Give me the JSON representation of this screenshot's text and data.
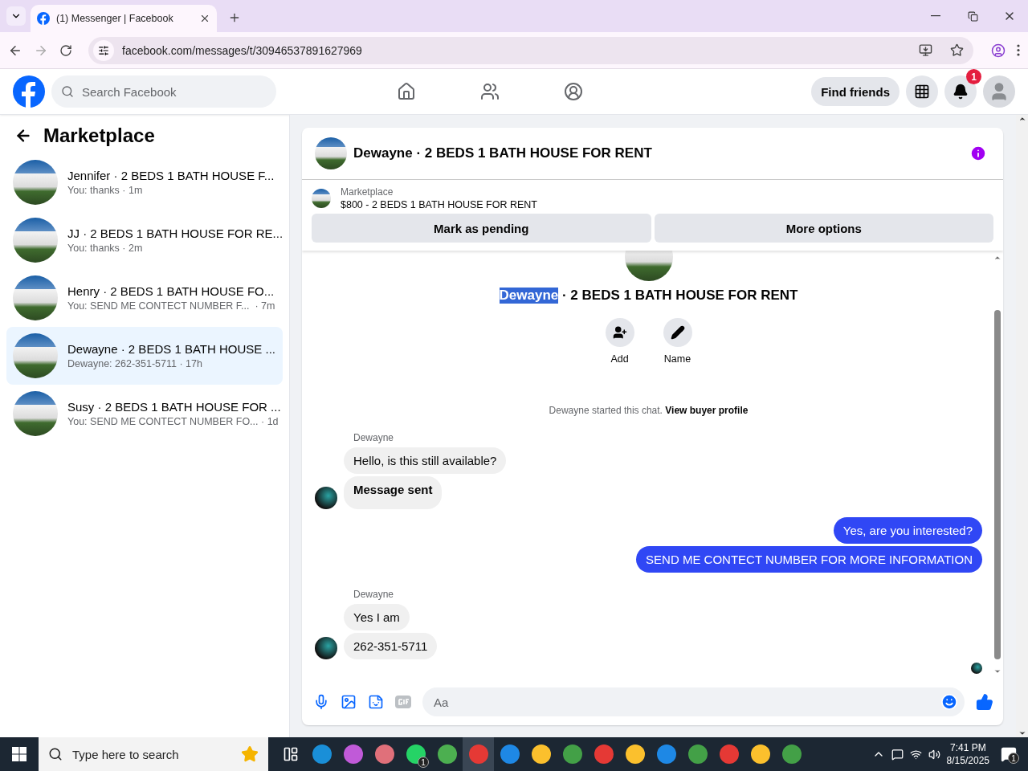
{
  "browser": {
    "tab_title": "(1) Messenger | Facebook",
    "url": "facebook.com/messages/t/30946537891627969"
  },
  "header": {
    "search_placeholder": "Search Facebook",
    "find_friends": "Find friends",
    "notification_count": "1"
  },
  "sidebar": {
    "title": "Marketplace",
    "conversations": [
      {
        "title": "Jennifer · 2 BEDS 1 BATH HOUSE F...",
        "preview": "You: thanks · 1m",
        "selected": false
      },
      {
        "title": "JJ · 2 BEDS 1 BATH HOUSE FOR RE...",
        "preview": "You: thanks · 2m",
        "selected": false
      },
      {
        "title": "Henry · 2 BEDS 1 BATH HOUSE FO...",
        "preview": "You: SEND ME CONTECT NUMBER F...  · 7m",
        "selected": false
      },
      {
        "title": "Dewayne · 2 BEDS 1 BATH HOUSE ...",
        "preview": "Dewayne: 262-351-5711 · 17h",
        "selected": true
      },
      {
        "title": "Susy · 2 BEDS 1 BATH HOUSE FOR ...",
        "preview": "You: SEND ME CONTECT NUMBER FO... · 1d",
        "selected": false
      }
    ]
  },
  "chat": {
    "title": "Dewayne · 2 BEDS 1 BATH HOUSE FOR RENT",
    "listing": {
      "source": "Marketplace",
      "title": "$800 - 2 BEDS 1 BATH HOUSE FOR RENT",
      "buttons": [
        "Mark as pending",
        "More options"
      ]
    },
    "intro": {
      "name": "Dewayne",
      "name_highlighted": true,
      "rest": " · 2 BEDS 1 BATH HOUSE FOR RENT",
      "actions": [
        {
          "kind": "add",
          "label": "Add"
        },
        {
          "kind": "name",
          "label": "Name"
        }
      ],
      "notice": "Dewayne started this chat.",
      "notice_link": "View buyer profile"
    },
    "groups": [
      {
        "kind": "incoming",
        "sender": "Dewayne",
        "messages": [
          {
            "text": "Hello, is this still available?",
            "bold": false
          },
          {
            "text": "Message sent",
            "bold": true
          }
        ]
      },
      {
        "kind": "outgoing",
        "messages": [
          {
            "text": "Yes, are you interested?",
            "bold": false
          },
          {
            "text": "SEND ME CONTECT NUMBER FOR MORE INFORMATION",
            "bold": false
          }
        ]
      },
      {
        "kind": "incoming",
        "sender": "Dewayne",
        "messages": [
          {
            "text": "Yes I am",
            "bold": false
          },
          {
            "text": "262-351-5711",
            "bold": false
          }
        ]
      }
    ],
    "composer_placeholder": "Aa"
  },
  "taskbar": {
    "search_placeholder": "Type here to search",
    "whatsapp_badge": "1",
    "time": "7:41 PM",
    "date": "8/15/2025",
    "notification_count": "1"
  }
}
